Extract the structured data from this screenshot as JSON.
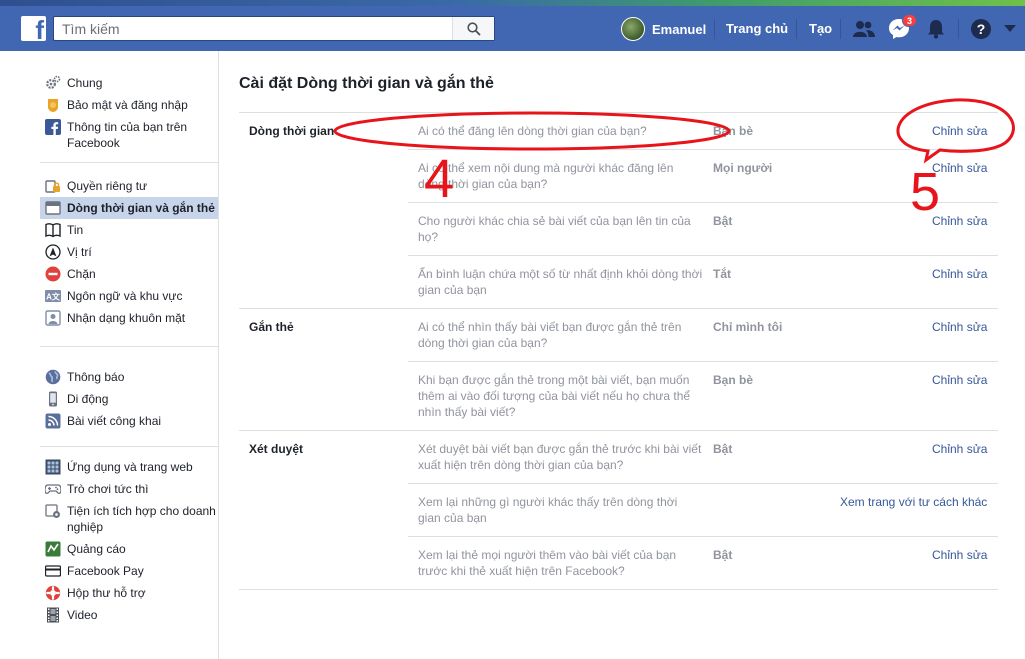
{
  "header": {
    "search_placeholder": "Tìm kiếm",
    "user_name": "Emanuel",
    "home_label": "Trang chủ",
    "create_label": "Tạo",
    "messenger_badge": "3"
  },
  "sidebar": {
    "group1": [
      {
        "label": "Chung",
        "icon": "gears-icon"
      },
      {
        "label": "Bảo mật và đăng nhập",
        "icon": "security-badge-icon"
      },
      {
        "label": "Thông tin của bạn trên Facebook",
        "icon": "facebook-icon"
      }
    ],
    "group2": [
      {
        "label": "Quyền riêng tư",
        "icon": "privacy-lock-icon"
      },
      {
        "label": "Dòng thời gian và gắn thẻ",
        "icon": "timeline-icon",
        "active": true
      },
      {
        "label": "Tin",
        "icon": "book-icon"
      },
      {
        "label": "Vị trí",
        "icon": "location-icon"
      },
      {
        "label": "Chặn",
        "icon": "block-icon"
      },
      {
        "label": "Ngôn ngữ và khu vực",
        "icon": "language-icon"
      },
      {
        "label": "Nhận dạng khuôn mặt",
        "icon": "face-recognition-icon"
      }
    ],
    "group3": [
      {
        "label": "Thông báo",
        "icon": "globe-icon"
      },
      {
        "label": "Di động",
        "icon": "mobile-icon"
      },
      {
        "label": "Bài viết công khai",
        "icon": "rss-icon"
      }
    ],
    "group4": [
      {
        "label": "Ứng dụng và trang web",
        "icon": "apps-icon"
      },
      {
        "label": "Trò chơi tức thì",
        "icon": "gamepad-icon"
      },
      {
        "label": "Tiện ích tích hợp cho doanh nghiệp",
        "icon": "business-integration-icon"
      },
      {
        "label": "Quảng cáo",
        "icon": "ads-icon"
      },
      {
        "label": "Facebook Pay",
        "icon": "payment-card-icon"
      },
      {
        "label": "Hộp thư hỗ trợ",
        "icon": "lifebuoy-icon"
      },
      {
        "label": "Video",
        "icon": "film-icon"
      }
    ]
  },
  "main": {
    "title": "Cài đặt Dòng thời gian và gắn thẻ",
    "sections": [
      {
        "label": "Dòng thời gian",
        "rows": [
          {
            "question": "Ai có thể đăng lên dòng thời gian của bạn?",
            "value": "Bạn bè",
            "action": "Chỉnh sửa"
          },
          {
            "question": "Ai có thể xem nội dung mà người khác đăng lên dòng thời gian của bạn?",
            "value": "Mọi người",
            "action": "Chỉnh sửa"
          },
          {
            "question": "Cho người khác chia sẻ bài viết của bạn lên tin của họ?",
            "value": "Bật",
            "action": "Chỉnh sửa"
          },
          {
            "question": "Ẩn bình luận chứa một số từ nhất định khỏi dòng thời gian của bạn",
            "value": "Tắt",
            "action": "Chỉnh sửa"
          }
        ]
      },
      {
        "label": "Gắn thẻ",
        "rows": [
          {
            "question": "Ai có thể nhìn thấy bài viết bạn được gắn thẻ trên dòng thời gian của bạn?",
            "value": "Chỉ mình tôi",
            "action": "Chỉnh sửa"
          },
          {
            "question": "Khi bạn được gắn thẻ trong một bài viết, bạn muốn thêm ai vào đối tượng của bài viết nếu họ chưa thể nhìn thấy bài viết?",
            "value": "Bạn bè",
            "action": "Chỉnh sửa"
          }
        ]
      },
      {
        "label": "Xét duyệt",
        "rows": [
          {
            "question": "Xét duyệt bài viết bạn được gắn thẻ trước khi bài viết xuất hiện trên dòng thời gian của bạn?",
            "value": "Bật",
            "action": "Chỉnh sửa"
          },
          {
            "question": "Xem lại những gì người khác thấy trên dòng thời gian của bạn",
            "value": "",
            "action": "Xem trang với tư cách khác"
          },
          {
            "question": "Xem lại thẻ mọi người thêm vào bài viết của bạn trước khi thẻ xuất hiện trên Facebook?",
            "value": "Bật",
            "action": "Chỉnh sửa"
          }
        ]
      }
    ]
  },
  "annotations": {
    "step_a": "4",
    "step_b": "5",
    "color": "#e8141c"
  }
}
